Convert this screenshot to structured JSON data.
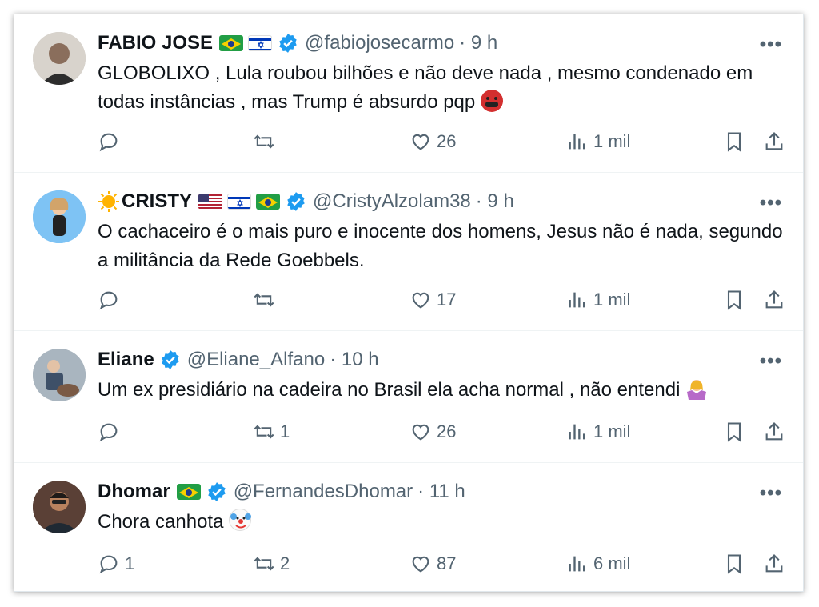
{
  "tweets": [
    {
      "name": "FABIO JOSE",
      "flags": [
        "brazil-flag",
        "israel-flag"
      ],
      "handle": "@fabiojosecarmo",
      "time": "· 9 h",
      "text": "GLOBOLIXO , Lula roubou bilhões e não deve nada , mesmo condenado em todas instâncias , mas Trump é absurdo pqp",
      "emoji": "face-with-symbols-on-mouth-emoji",
      "replies": "",
      "retweets": "",
      "likes": "26",
      "views": "1 mil"
    },
    {
      "name": "CRISTY",
      "flags": [
        "usa-flag",
        "israel-flag",
        "brazil-flag"
      ],
      "handle": "@CristyAlzolam38",
      "time": "· 9 h",
      "text": "O cachaceiro é o mais puro e inocente dos homens, Jesus não é nada, segundo a militância da Rede Goebbels.",
      "emoji": "",
      "replies": "",
      "retweets": "",
      "likes": "17",
      "views": "1 mil"
    },
    {
      "name": "Eliane",
      "flags": [],
      "handle": "@Eliane_Alfano",
      "time": "· 10 h",
      "text": "Um ex presidiário na cadeira no Brasil ela acha normal , não entendi",
      "emoji": "woman-shrugging-emoji",
      "replies": "",
      "retweets": "1",
      "likes": "26",
      "views": "1 mil"
    },
    {
      "name": "Dhomar",
      "flags": [
        "brazil-flag"
      ],
      "handle": "@FernandesDhomar",
      "time": "· 11 h",
      "text": "Chora canhota",
      "emoji": "clown-face-emoji",
      "replies": "1",
      "retweets": "2",
      "likes": "87",
      "views": "6 mil"
    }
  ],
  "more_label": "•••",
  "colors": {
    "verified": "#1d9bf0",
    "text": "#0f1419",
    "secondary": "#536471"
  }
}
